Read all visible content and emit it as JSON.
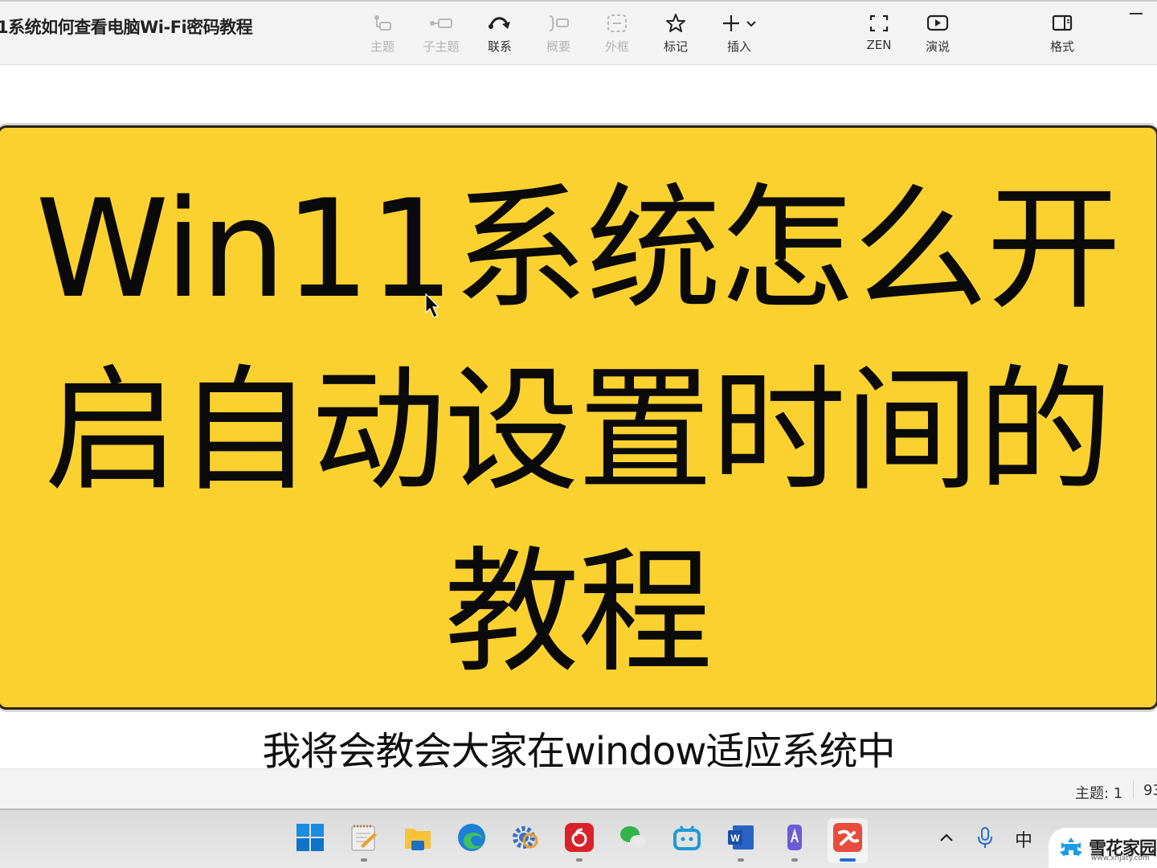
{
  "toolbar": {
    "document_title": "1系统如何查看电脑Wi-Fi密码教程",
    "tools": [
      {
        "id": "topic",
        "label": "主题",
        "icon": "topic-icon",
        "enabled": false
      },
      {
        "id": "subtopic",
        "label": "子主题",
        "icon": "subtopic-icon",
        "enabled": false
      },
      {
        "id": "relationship",
        "label": "联系",
        "icon": "relationship-arrow-icon",
        "enabled": true
      },
      {
        "id": "summary",
        "label": "概要",
        "icon": "summary-brace-icon",
        "enabled": false
      },
      {
        "id": "boundary",
        "label": "外框",
        "icon": "boundary-icon",
        "enabled": false
      },
      {
        "id": "marker",
        "label": "标记",
        "icon": "star-icon",
        "enabled": true
      },
      {
        "id": "insert",
        "label": "插入",
        "icon": "plus-icon",
        "enabled": true
      },
      {
        "id": "zen",
        "label": "ZEN",
        "icon": "fullscreen-icon",
        "enabled": true
      },
      {
        "id": "pitch",
        "label": "演说",
        "icon": "play-icon",
        "enabled": true
      },
      {
        "id": "format",
        "label": "格式",
        "icon": "panel-icon",
        "enabled": true
      }
    ]
  },
  "canvas": {
    "central_topic": {
      "lines": [
        "Win11系统怎么开",
        "启自动设置时间的",
        "教程"
      ],
      "background_color": "#fbd12f"
    },
    "subtitle": "我将会教会大家在window适应系统中"
  },
  "statusbar": {
    "topics_label": "主题: 1",
    "zoom_partial": "93"
  },
  "taskbar": {
    "apps": [
      {
        "name": "start",
        "icon": "windows-start-icon"
      },
      {
        "name": "notepad",
        "icon": "notepad-icon",
        "running": true
      },
      {
        "name": "file-explorer",
        "icon": "folder-icon"
      },
      {
        "name": "edge",
        "icon": "edge-icon"
      },
      {
        "name": "settings-tool",
        "icon": "gear-tool-icon"
      },
      {
        "name": "netease-music",
        "icon": "netease-music-icon",
        "running": true
      },
      {
        "name": "wechat",
        "icon": "wechat-icon"
      },
      {
        "name": "bilibili",
        "icon": "bilibili-icon"
      },
      {
        "name": "word",
        "icon": "word-icon",
        "running": true
      },
      {
        "name": "phone-link",
        "icon": "phone-app-icon",
        "running": true
      },
      {
        "name": "xmind",
        "icon": "xmind-icon",
        "running": true,
        "active": true
      }
    ],
    "tray": {
      "chevron": "^",
      "ime": "中"
    }
  },
  "watermark": {
    "name": "雪花家园",
    "url": "www.xhjaty.com"
  }
}
